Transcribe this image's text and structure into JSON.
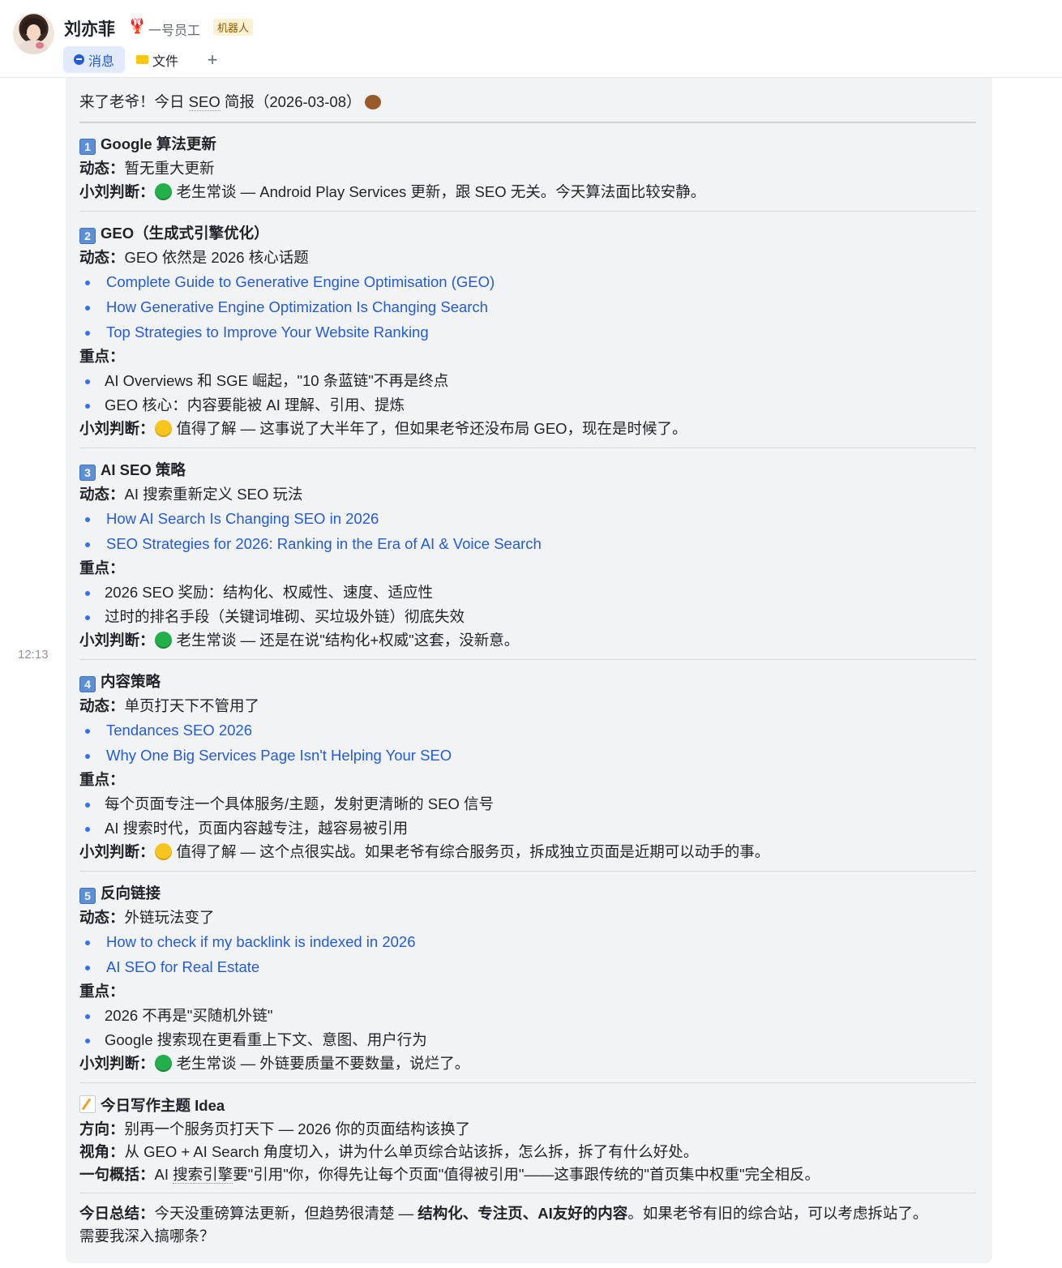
{
  "header": {
    "name": "刘亦菲",
    "role": "一号员工",
    "badge": "机器人",
    "tabs": [
      {
        "label": "消息"
      },
      {
        "label": "文件"
      },
      {
        "label": "+"
      }
    ]
  },
  "message": {
    "time": "12:13",
    "intro_prefix": "来了老爷！今日 ",
    "intro_seo": "SEO",
    "intro_suffix": " 简报（2026-03-08）",
    "sections": [
      {
        "num": "1",
        "title": "Google 算法更新",
        "dynamic_label": "动态：",
        "dynamic": "暂无重大更新",
        "links": [],
        "key_label": "",
        "keys": [],
        "verdict_label": "小刘判断：",
        "verdict_color": "green",
        "verdict": "老生常谈 — Android Play Services 更新，跟 SEO 无关。今天算法面比较安静。"
      },
      {
        "num": "2",
        "title": "GEO（生成式引擎优化）",
        "dynamic_label": "动态：",
        "dynamic": "GEO 依然是 2026 核心话题",
        "links": [
          "Complete Guide to Generative Engine Optimisation (GEO)",
          "How Generative Engine Optimization Is Changing Search",
          "Top Strategies to Improve Your Website Ranking"
        ],
        "key_label": "重点：",
        "keys": [
          "AI Overviews 和 SGE 崛起，\"10 条蓝链\"不再是终点",
          "GEO 核心：内容要能被 AI 理解、引用、提炼"
        ],
        "verdict_label": "小刘判断：",
        "verdict_color": "yellow",
        "verdict": "值得了解 — 这事说了大半年了，但如果老爷还没布局 GEO，现在是时候了。"
      },
      {
        "num": "3",
        "title": "AI SEO 策略",
        "dynamic_label": "动态：",
        "dynamic": "AI 搜索重新定义 SEO 玩法",
        "links": [
          "How AI Search Is Changing SEO in 2026",
          "SEO Strategies for 2026: Ranking in the Era of AI & Voice Search"
        ],
        "key_label": "重点：",
        "keys": [
          "2026 SEO 奖励：结构化、权威性、速度、适应性",
          "过时的排名手段（关键词堆砌、买垃圾外链）彻底失效"
        ],
        "verdict_label": "小刘判断：",
        "verdict_color": "green",
        "verdict": "老生常谈 — 还是在说\"结构化+权威\"这套，没新意。"
      },
      {
        "num": "4",
        "title": "内容策略",
        "dynamic_label": "动态：",
        "dynamic": "单页打天下不管用了",
        "links": [
          "Tendances SEO 2026",
          "Why One Big Services Page Isn't Helping Your SEO"
        ],
        "key_label": "重点：",
        "keys": [
          "每个页面专注一个具体服务/主题，发射更清晰的 SEO 信号",
          "AI 搜索时代，页面内容越专注，越容易被引用"
        ],
        "verdict_label": "小刘判断：",
        "verdict_color": "yellow",
        "verdict": "值得了解 — 这个点很实战。如果老爷有综合服务页，拆成独立页面是近期可以动手的事。"
      },
      {
        "num": "5",
        "title": "反向链接",
        "dynamic_label": "动态：",
        "dynamic": "外链玩法变了",
        "links": [
          "How to check if my backlink is indexed in 2026",
          "AI SEO for Real Estate"
        ],
        "key_label": "重点：",
        "keys": [
          "2026 不再是\"买随机外链\"",
          "Google 搜索现在更看重上下文、意图、用户行为"
        ],
        "verdict_label": "小刘判断：",
        "verdict_color": "green",
        "verdict": "老生常谈 — 外链要质量不要数量，说烂了。"
      }
    ],
    "idea": {
      "title": "今日写作主题 Idea",
      "direction_label": "方向：",
      "direction": "别再一个服务页打天下 — 2026 你的页面结构该换了",
      "angle_label": "视角：",
      "angle": "从 GEO + AI Search 角度切入，讲为什么单页综合站该拆，怎么拆，拆了有什么好处。",
      "summary_label": "一句概括：",
      "summary_prefix": "AI ",
      "summary_dotted": "搜索引擎",
      "summary_rest": "要\"引用\"你，你得先让每个页面\"值得被引用\"——这事跟传统的\"首页集中权重\"完全相反。"
    },
    "conclusion": {
      "label": "今日总结：",
      "text1": "今天没重磅算法更新，但趋势很清楚 — ",
      "bold": "结构化、专注页、AI友好的内容",
      "text2": "。如果老爷有旧的综合站，可以考虑拆站了。",
      "line2": "需要我深入搞哪条？"
    }
  }
}
